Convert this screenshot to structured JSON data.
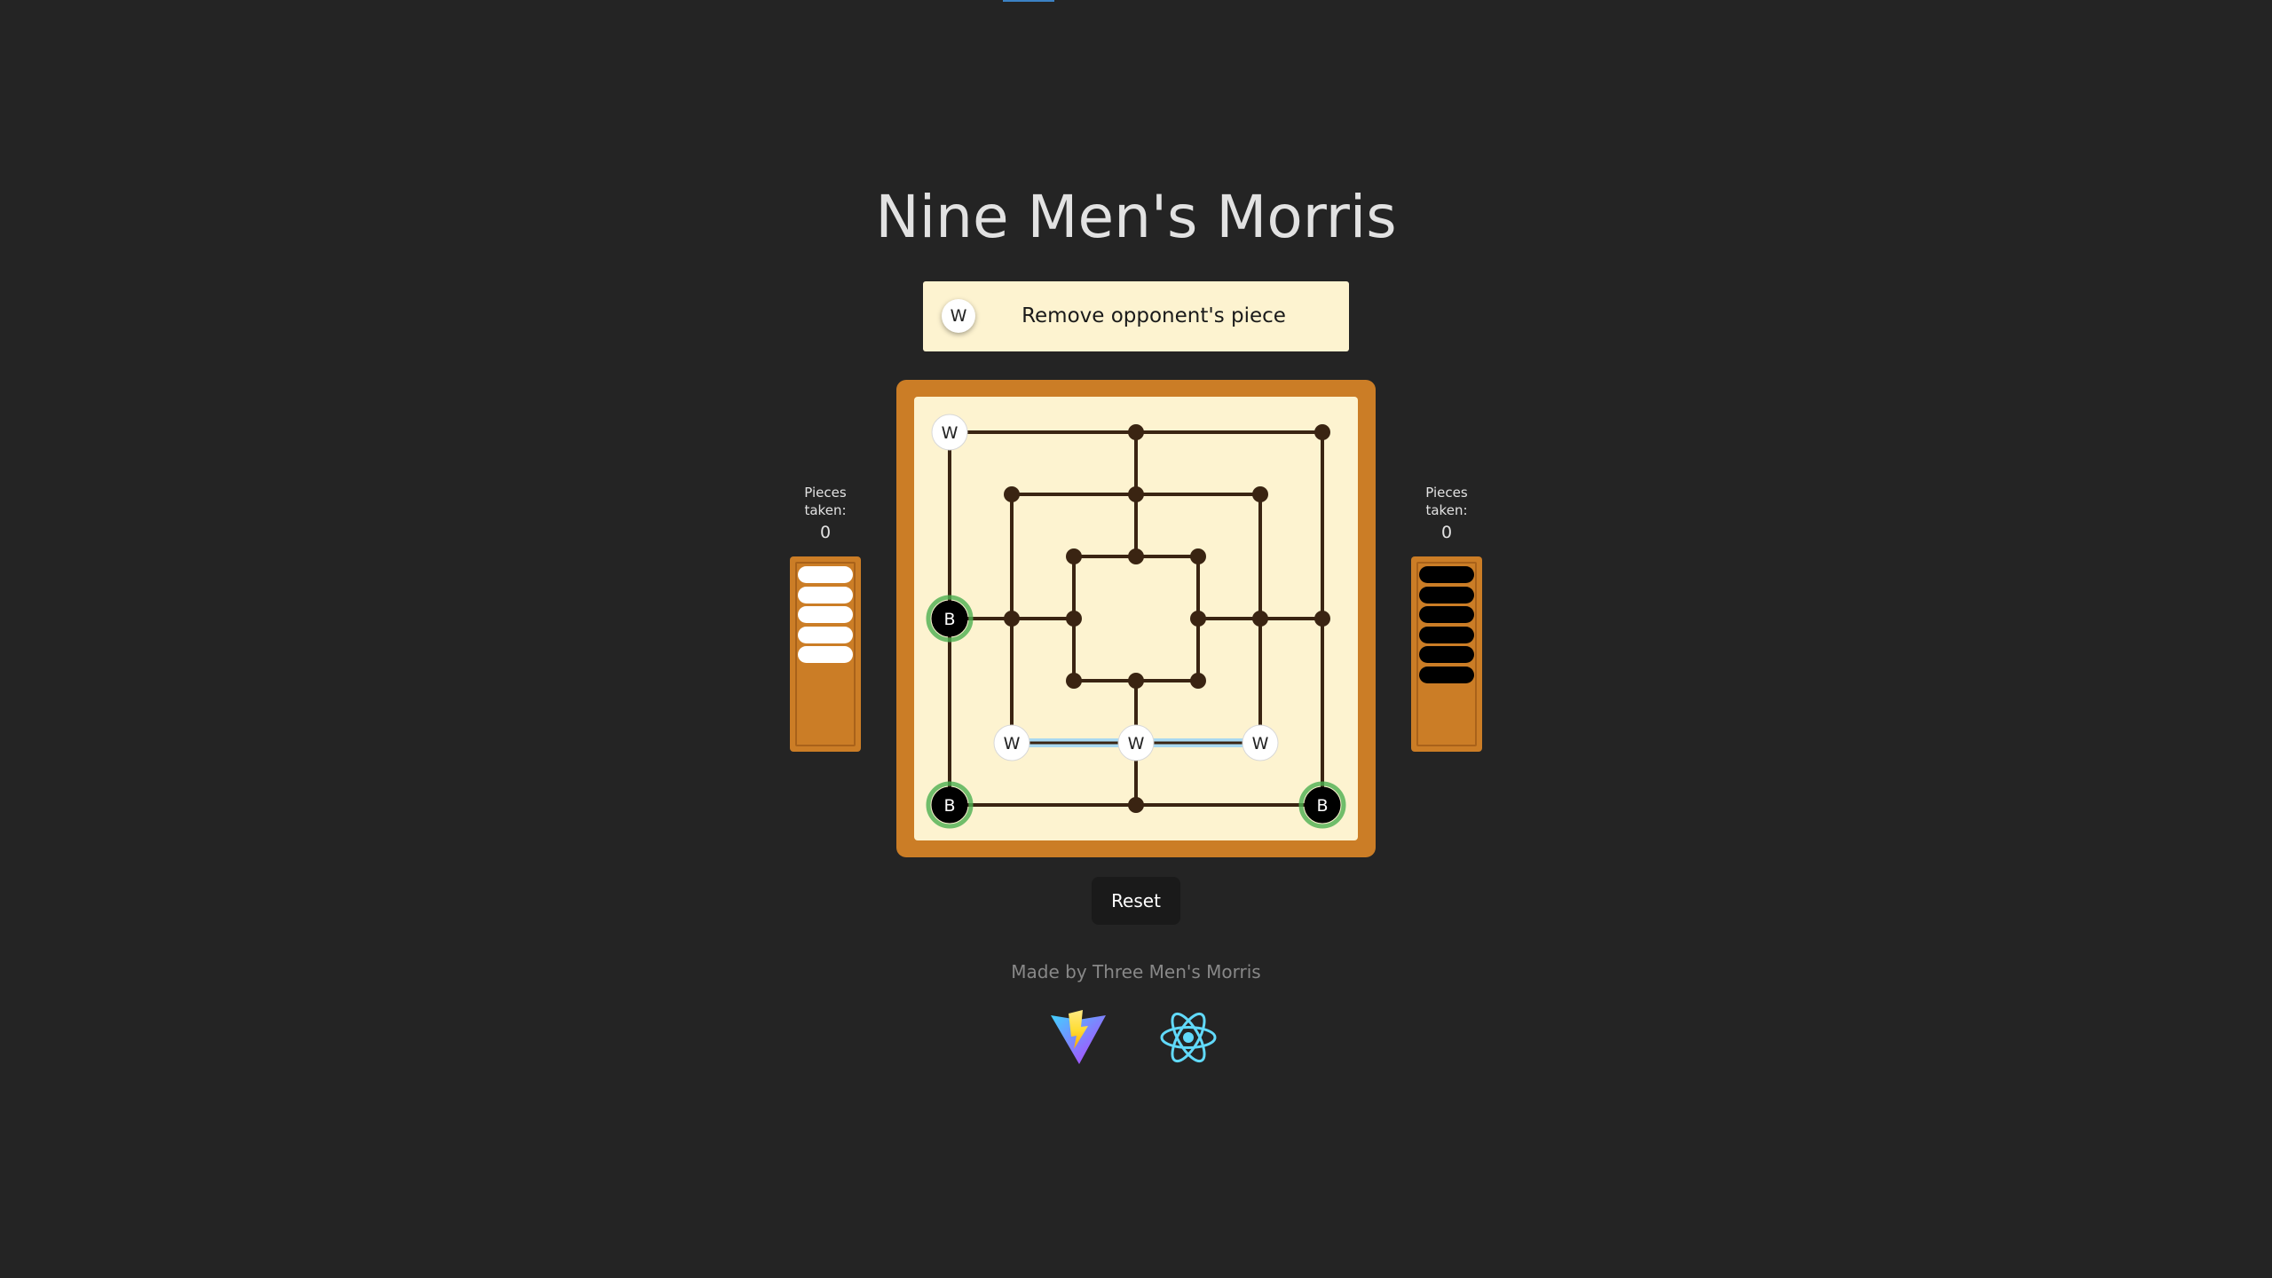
{
  "title": "Nine Men's Morris",
  "status": {
    "piece": "W",
    "message": "Remove opponent's piece"
  },
  "left_panel": {
    "label": "Pieces taken:",
    "count": "0",
    "tray_piece_color": "#ffffff",
    "tray_pieces": 5
  },
  "right_panel": {
    "label": "Pieces taken:",
    "count": "0",
    "tray_piece_color": "#000000",
    "tray_pieces": 6
  },
  "board": {
    "pieces": [
      {
        "point": "outer-top-left",
        "player": "W"
      },
      {
        "point": "outer-middle-left",
        "player": "B",
        "highlighted": true
      },
      {
        "point": "outer-bottom-left",
        "player": "B",
        "highlighted": true
      },
      {
        "point": "outer-bottom-right",
        "player": "B",
        "highlighted": true
      },
      {
        "point": "middle-bottom-left",
        "player": "W"
      },
      {
        "point": "middle-bottom-middle",
        "player": "W"
      },
      {
        "point": "middle-bottom-right",
        "player": "W"
      }
    ],
    "mill": [
      "middle-bottom-left",
      "middle-bottom-middle",
      "middle-bottom-right"
    ]
  },
  "reset_label": "Reset",
  "credit": "Made by Three Men's Morris",
  "logos": [
    "vite-logo",
    "react-logo"
  ],
  "colors": {
    "board_frame": "#cb7d26",
    "board_surface": "#fdf3d0",
    "line": "#3a2412",
    "highlight": "#4caf50",
    "mill": "#a8d8f0"
  }
}
